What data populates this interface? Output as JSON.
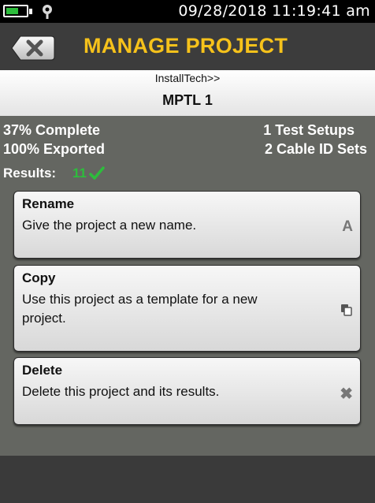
{
  "status_bar": {
    "datetime": "09/28/2018 11:19:41 am",
    "battery_color": "#2dbd3c",
    "battery_level": 0.55
  },
  "header": {
    "title": "MANAGE PROJECT",
    "title_color": "#f6c21b",
    "back_icon": "close-x-icon"
  },
  "breadcrumb": {
    "path": "InstallTech>>",
    "project_name": "MPTL 1"
  },
  "summary": {
    "complete": "37% Complete",
    "exported": "100% Exported",
    "test_setups": "1 Test Setups",
    "cable_id_sets": "2 Cable ID Sets",
    "results_label": "Results:",
    "results_count": "11",
    "results_color": "#2dbd3c"
  },
  "options": [
    {
      "title": "Rename",
      "description": "Give the project a new name.",
      "icon": "A"
    },
    {
      "title": "Copy",
      "description": "Use this project as a template for a new project.",
      "icon": "copy-icon"
    },
    {
      "title": "Delete",
      "description": "Delete this project and its results.",
      "icon": "✖"
    }
  ]
}
